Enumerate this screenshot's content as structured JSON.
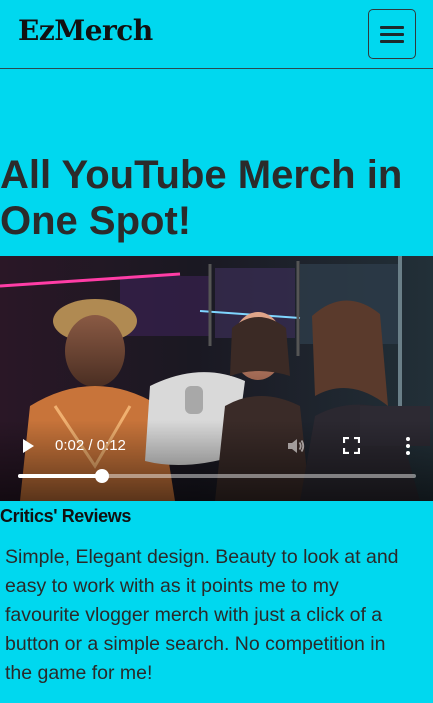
{
  "nav": {
    "brand": "EzMerch",
    "menu_icon": "hamburger-menu-icon"
  },
  "hero": {
    "title": "All YouTube Merch in One Spot!"
  },
  "video": {
    "time_display": "0:02 / 0:12",
    "progress_fraction": 0.21,
    "icons": {
      "play": "play-icon",
      "volume": "volume-icon",
      "fullscreen": "fullscreen-icon",
      "more": "more-options-icon"
    }
  },
  "reviews": {
    "heading": "Critics' Reviews",
    "text": "Simple, Elegant design. Beauty to look at and easy to work with as it points me to my favourite vlogger merch with just a click of a button or a simple search. No competition in the game for me!"
  },
  "colors": {
    "background": "#00d8ef",
    "text": "#2b2b2b"
  }
}
